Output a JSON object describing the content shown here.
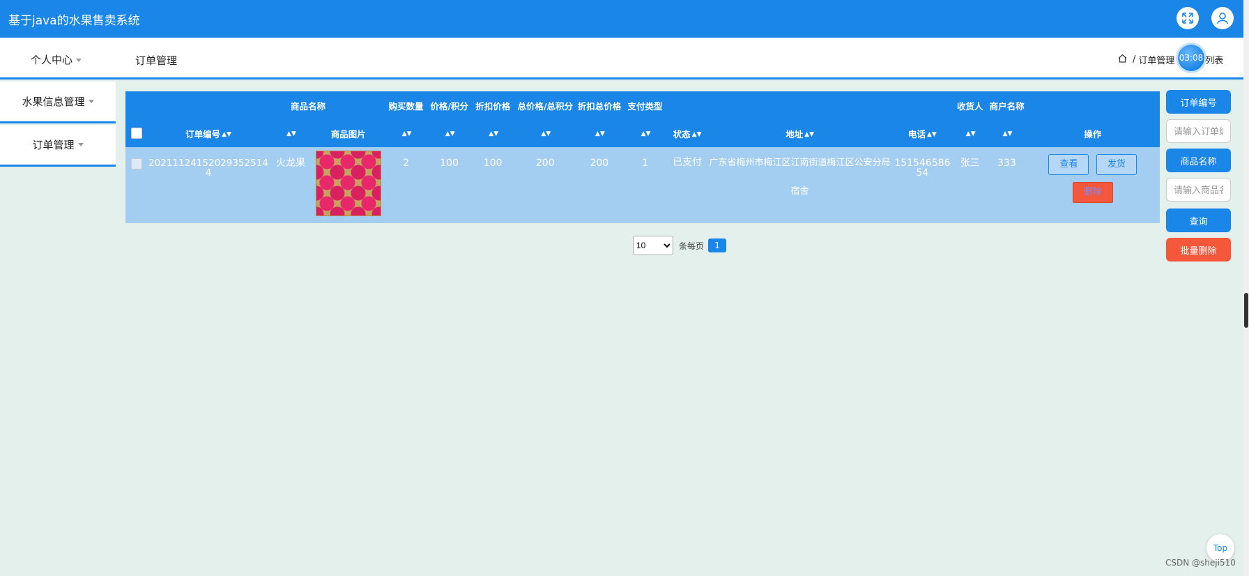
{
  "app": {
    "title": "基于java的水果售卖系统"
  },
  "header": {
    "icons": [
      "fullscreen-icon",
      "user-icon"
    ]
  },
  "subbar": {
    "personal_label": "个人中心",
    "page_title": "订单管理",
    "breadcrumb": {
      "sep": "/",
      "section": "订单管理",
      "current": "列表"
    },
    "timer": "03:08"
  },
  "sidebar": {
    "items": [
      {
        "label": "水果信息管理"
      },
      {
        "label": "订单管理"
      }
    ]
  },
  "table": {
    "header_top": {
      "goods_name": "商品名称",
      "buy_qty": "购买数量",
      "price": "价格/积分",
      "discount_price": "折扣价格",
      "total": "总价格/总积分",
      "discount_total": "折扣总价格",
      "pay_type": "支付类型",
      "receiver": "收货人",
      "merchant": "商户名称"
    },
    "header_bottom": {
      "order_no": "订单编号",
      "goods_img": "商品图片",
      "status": "状态",
      "address": "地址",
      "phone": "电话",
      "actions": "操作"
    },
    "sort_arrow": "▲▼",
    "rows": [
      {
        "order_no": "20211124152029352514 4",
        "order_no_display": "202111241520293525144",
        "goods_name": "火龙果",
        "buy_qty": "2",
        "price": "100",
        "discount_price": "100",
        "total": "200",
        "discount_total": "200",
        "pay_type": "1",
        "status": "已支付",
        "address": "广东省梅州市梅江区江南街道梅江区公安分局宿舍",
        "phone": "15154658654",
        "receiver": "张三",
        "merchant": "333",
        "view_label": "查看",
        "ship_label": "发货",
        "delete_label": "删除"
      }
    ]
  },
  "pager": {
    "page_size": "10",
    "page_size_options": [
      "10"
    ],
    "per_page_label": "条每页",
    "current_page": "1"
  },
  "search": {
    "order_no_label": "订单编号",
    "order_no_placeholder": "请输入订单编号",
    "goods_name_label": "商品名称",
    "goods_name_placeholder": "请输入商品名称",
    "query_label": "查询",
    "batch_delete_label": "批量删除"
  },
  "footer": {
    "top_label": "Top",
    "watermark": "CSDN @sheji510"
  }
}
